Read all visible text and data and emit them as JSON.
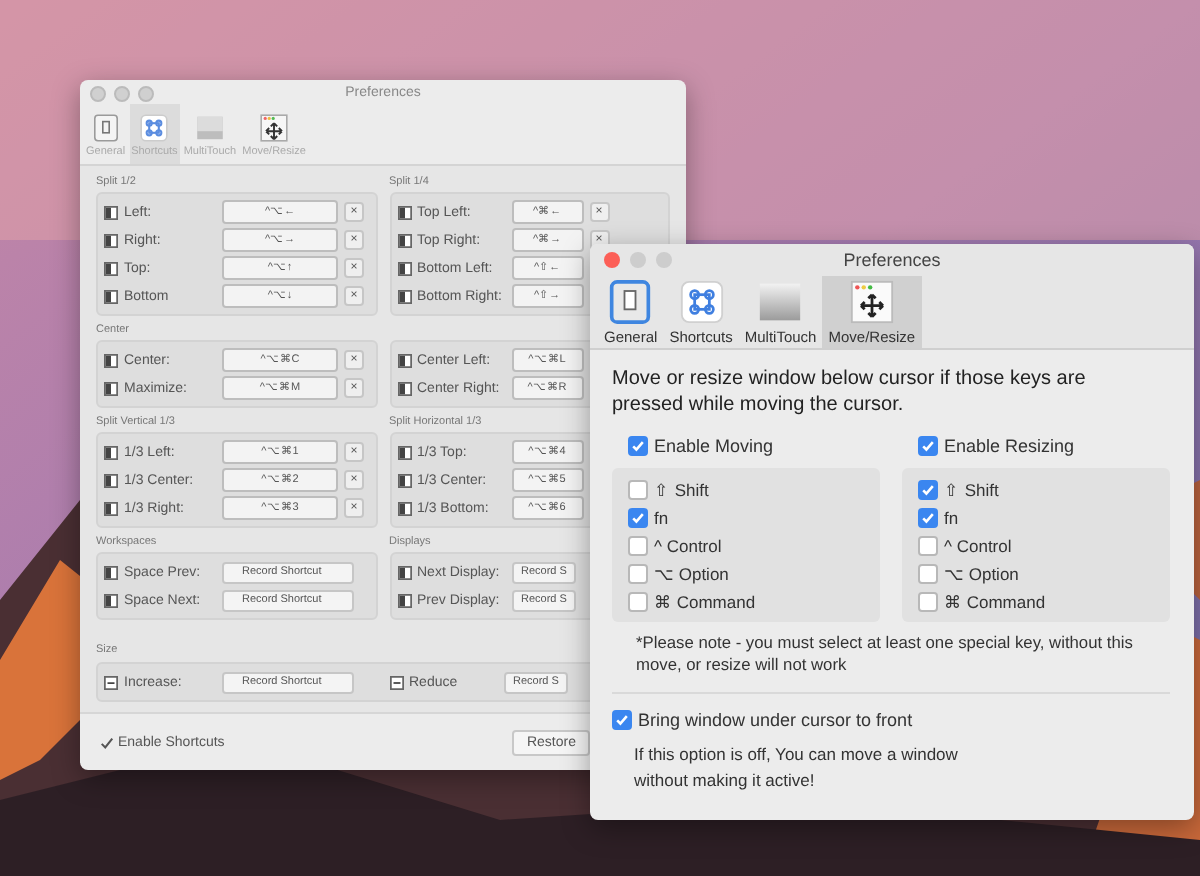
{
  "back_window": {
    "title": "Preferences",
    "tabs": [
      {
        "label": "General",
        "selected": false
      },
      {
        "label": "Shortcuts",
        "selected": true
      },
      {
        "label": "MultiTouch",
        "selected": false
      },
      {
        "label": "Move/Resize",
        "selected": false
      }
    ],
    "blocks": [
      {
        "kind": "pair",
        "left": {
          "title": "Split 1/2",
          "rows": [
            {
              "kind": "key",
              "label": "Left:",
              "shortcut": "^⌥←",
              "clear": "×"
            },
            {
              "kind": "key",
              "label": "Right:",
              "shortcut": "^⌥→",
              "clear": "×"
            },
            {
              "kind": "key",
              "label": "Top:",
              "shortcut": "^⌥↑",
              "clear": "×"
            },
            {
              "kind": "key",
              "label": "Bottom",
              "shortcut": "^⌥↓",
              "clear": "×"
            }
          ]
        },
        "right": {
          "title": "Split 1/4",
          "rows": [
            {
              "kind": "key",
              "label": "Top Left:",
              "shortcut": "^⌘←",
              "clear": "×"
            },
            {
              "kind": "key",
              "label": "Top Right:",
              "shortcut": "^⌘→",
              "clear": "×"
            },
            {
              "kind": "key",
              "label": "Bottom Left:",
              "shortcut": "^⇧←"
            },
            {
              "kind": "key",
              "label": "Bottom Right:",
              "shortcut": "^⇧→"
            }
          ]
        }
      },
      {
        "kind": "pair",
        "left": {
          "title": "Center",
          "rows": [
            {
              "kind": "key",
              "label": "Center:",
              "shortcut": "^⌥⌘C",
              "clear": "×"
            },
            {
              "kind": "key",
              "label": "Maximize:",
              "shortcut": "^⌥⌘M",
              "clear": "×"
            }
          ]
        },
        "right": {
          "rows": [
            {
              "kind": "key",
              "label": "Center Left:",
              "shortcut": "^⌥⌘L"
            },
            {
              "kind": "key",
              "label": "Center Right:",
              "shortcut": "^⌥⌘R"
            }
          ]
        }
      },
      {
        "kind": "pair",
        "left": {
          "title": "Split Vertical 1/3",
          "rows": [
            {
              "kind": "key",
              "label": "1/3 Left:",
              "shortcut": "^⌥⌘1",
              "clear": "×"
            },
            {
              "kind": "key",
              "label": "1/3 Center:",
              "shortcut": "^⌥⌘2",
              "clear": "×"
            },
            {
              "kind": "key",
              "label": "1/3 Right:",
              "shortcut": "^⌥⌘3",
              "clear": "×"
            }
          ]
        },
        "right": {
          "title": "Split Horizontal 1/3",
          "rows": [
            {
              "kind": "key",
              "label": "1/3 Top:",
              "shortcut": "^⌥⌘4"
            },
            {
              "kind": "key",
              "label": "1/3 Center:",
              "shortcut": "^⌥⌘5"
            },
            {
              "kind": "key",
              "label": "1/3 Bottom:",
              "shortcut": "^⌥⌘6"
            }
          ]
        }
      },
      {
        "kind": "pair",
        "left": {
          "title": "Workspaces",
          "rows": [
            {
              "kind": "record",
              "label": "Space Prev:",
              "button": "Record Shortcut"
            },
            {
              "kind": "record",
              "label": "Space Next:",
              "button": "Record Shortcut"
            }
          ]
        },
        "right": {
          "title": "Displays",
          "rows": [
            {
              "kind": "record",
              "label": "Next Display:",
              "button": "Record S"
            },
            {
              "kind": "record",
              "label": "Prev Display:",
              "button": "Record S"
            }
          ]
        }
      },
      {
        "kind": "wide",
        "left": {
          "title": "Size",
          "rows": [
            {
              "kind": "record",
              "label": "Increase:",
              "button": "Record Shortcut"
            }
          ]
        },
        "right": {
          "rows": [
            {
              "kind": "record",
              "label": "Reduce",
              "button": "Record S"
            }
          ]
        }
      }
    ],
    "enable_shortcuts": {
      "label": "Enable Shortcuts",
      "checked": true
    },
    "restore_button": "Restore"
  },
  "front_window": {
    "title": "Preferences",
    "tabs": [
      {
        "label": "General",
        "selected": false
      },
      {
        "label": "Shortcuts",
        "selected": false
      },
      {
        "label": "MultiTouch",
        "selected": false
      },
      {
        "label": "Move/Resize",
        "selected": true
      }
    ],
    "description": "Move or resize window below cursor if those keys are pressed while moving the cursor.",
    "groups": [
      {
        "label": "Enable Moving",
        "checked": true,
        "keys": [
          {
            "label": "⇧ Shift",
            "checked": false
          },
          {
            "label": "fn",
            "checked": true
          },
          {
            "label": "^ Control",
            "checked": false
          },
          {
            "label": "⌥ Option",
            "checked": false
          },
          {
            "label": "⌘ Command",
            "checked": false
          }
        ]
      },
      {
        "label": "Enable Resizing",
        "checked": true,
        "keys": [
          {
            "label": "⇧ Shift",
            "checked": true
          },
          {
            "label": "fn",
            "checked": true
          },
          {
            "label": "^ Control",
            "checked": false
          },
          {
            "label": "⌥ Option",
            "checked": false
          },
          {
            "label": "⌘ Command",
            "checked": false
          }
        ]
      }
    ],
    "note": "*Please note - you must select at least one special key, without this move, or resize will not work",
    "bring_to_front": {
      "label": "Bring window under cursor to front",
      "checked": true
    },
    "hint": "If this option is off, You can move a window without making it active!"
  }
}
